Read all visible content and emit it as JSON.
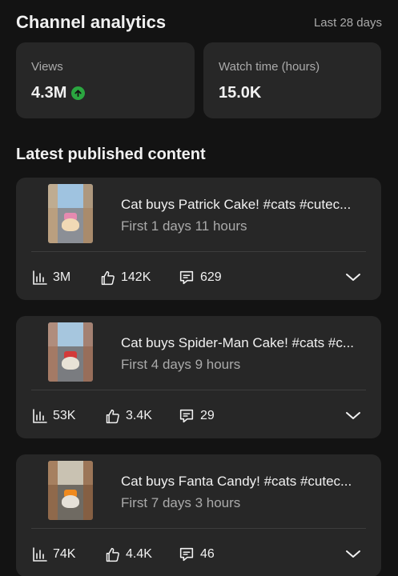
{
  "header": {
    "title": "Channel analytics",
    "period": "Last 28 days"
  },
  "stats": {
    "views": {
      "label": "Views",
      "value": "4.3M",
      "trend_icon": "arrow-up-icon",
      "trend_color": "#2ba640"
    },
    "watch_time": {
      "label": "Watch time (hours)",
      "value": "15.0K"
    }
  },
  "section": {
    "title": "Latest published content"
  },
  "videos": [
    {
      "title": "Cat buys Patrick Cake! #cats #cutec...",
      "age": "First 1 days 11 hours",
      "views": "3M",
      "likes": "142K",
      "comments": "629"
    },
    {
      "title": "Cat buys Spider-Man Cake! #cats #c...",
      "age": "First 4 days 9 hours",
      "views": "53K",
      "likes": "3.4K",
      "comments": "29"
    },
    {
      "title": "Cat buys Fanta Candy! #cats #cutec...",
      "age": "First 7 days 3 hours",
      "views": "74K",
      "likes": "4.4K",
      "comments": "46"
    }
  ],
  "colors": {
    "background": "#131313",
    "card": "#272727",
    "text_primary": "#f1f1f1",
    "text_secondary": "#aaaaaa",
    "accent_green": "#2ba640"
  }
}
